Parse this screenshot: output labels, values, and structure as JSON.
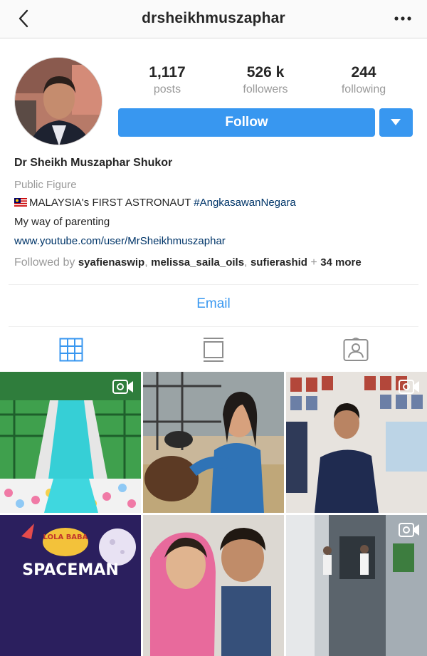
{
  "header": {
    "username": "drsheikhmuszaphar"
  },
  "stats": [
    {
      "value": "1,117",
      "label": "posts"
    },
    {
      "value": "526 k",
      "label": "followers"
    },
    {
      "value": "244",
      "label": "following"
    }
  ],
  "actions": {
    "follow_label": "Follow"
  },
  "bio": {
    "name": "Dr Sheikh Muszaphar Shukor",
    "category": "Public Figure",
    "line1_text": "MALAYSIA's FIRST ASTRONAUT ",
    "line1_hashtag": "#AngkasawanNegara",
    "line2": "My way of parenting",
    "link": "www.youtube.com/user/MrSheikhmuszaphar",
    "followed_by_prefix": "Followed by ",
    "followed_by_users": [
      "syafienaswip",
      "melissa_saila_oils",
      "sufierashid"
    ],
    "followed_by_more": "34 more"
  },
  "contact": {
    "email_label": "Email"
  },
  "tabs": [
    {
      "name": "grid-view",
      "active": true
    },
    {
      "name": "feed-view",
      "active": false
    },
    {
      "name": "tagged-view",
      "active": false
    }
  ],
  "grid_text": {
    "tile4_title": "SPACEMAN",
    "tile4_logo": "LOLA BABA"
  },
  "colors": {
    "accent": "#3897f0",
    "link": "#003569",
    "muted": "#999999"
  }
}
